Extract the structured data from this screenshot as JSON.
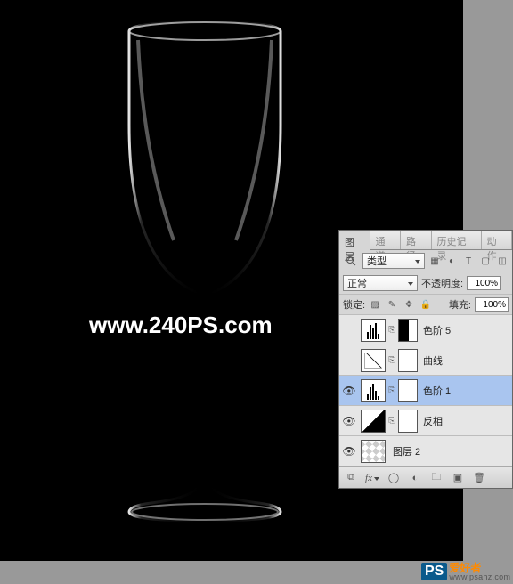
{
  "canvas": {
    "watermark_url": "www.240PS.com",
    "site_badge": "PS",
    "site_name": "爱好者",
    "site_url": "www.psahz.com"
  },
  "panel": {
    "tabs": [
      "图层",
      "通道",
      "路径",
      "历史记录",
      "动作"
    ],
    "active_tab": 0,
    "filter_label": "类型",
    "blend_mode": "正常",
    "opacity_label": "不透明度:",
    "opacity_value": "100%",
    "lock_label": "锁定:",
    "fill_label": "填充:",
    "fill_value": "100%",
    "layers": [
      {
        "visible": false,
        "type": "levels",
        "mask": "bw",
        "name": "色阶 5",
        "selected": false
      },
      {
        "visible": false,
        "type": "curves",
        "mask": "white",
        "name": "曲线",
        "selected": false
      },
      {
        "visible": true,
        "type": "levels",
        "mask": "white",
        "name": "色阶 1",
        "selected": true
      },
      {
        "visible": true,
        "type": "invert",
        "mask": "white",
        "name": "反相",
        "selected": false
      },
      {
        "visible": true,
        "type": "trans",
        "mask": null,
        "name": "图层 2",
        "selected": false
      }
    ],
    "bottom_icons": [
      "link",
      "fx",
      "mask",
      "adj",
      "group",
      "new",
      "trash"
    ]
  }
}
